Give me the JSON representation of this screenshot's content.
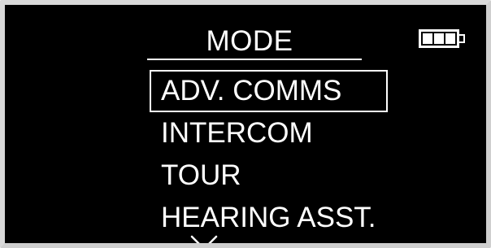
{
  "header": {
    "title": "MODE",
    "battery_icon": "battery-full-icon",
    "battery_level": 1.0
  },
  "menu": {
    "items": [
      {
        "label": "ADV. COMMS",
        "selected": true
      },
      {
        "label": "INTERCOM",
        "selected": false
      },
      {
        "label": "TOUR",
        "selected": false
      },
      {
        "label": "HEARING ASST.",
        "selected": false
      }
    ],
    "more_indicator_icon": "chevron-down-icon"
  },
  "colors": {
    "background": "#000000",
    "foreground": "#ffffff",
    "bezel": "#d9d9d9"
  }
}
